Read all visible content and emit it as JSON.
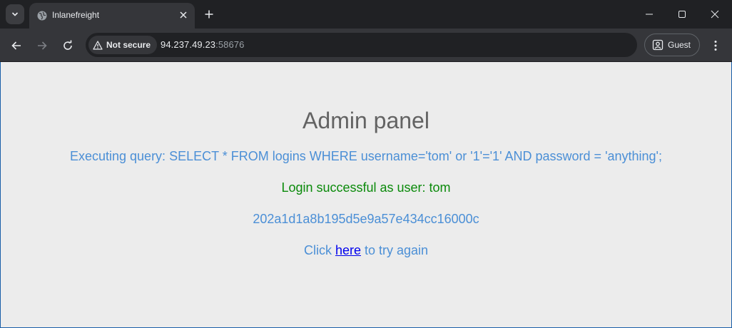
{
  "browser": {
    "tab": {
      "title": "Inlanefreight"
    },
    "security": {
      "label": "Not secure"
    },
    "address": {
      "host": "94.237.49.23",
      "port": ":58676"
    },
    "profile": {
      "label": "Guest"
    }
  },
  "page": {
    "title": "Admin panel",
    "query": "Executing query: SELECT * FROM logins WHERE username='tom' or '1'='1' AND password = 'anything';",
    "success": "Login successful as user: tom",
    "hash": "202a1d1a8b195d5e9a57e434cc16000c",
    "retry": {
      "prefix": "Click ",
      "link": "here",
      "suffix": " to try again"
    }
  },
  "colors": {
    "accent_text": "#4b8fd6",
    "success_text": "#0a8a0a",
    "title_text": "#636363",
    "page_background": "#ececec",
    "link": "#0000ee"
  },
  "icons": [
    "tab-search-icon",
    "globe-icon",
    "close-icon",
    "plus-icon",
    "minimize-icon",
    "maximize-icon",
    "back-arrow-icon",
    "forward-arrow-icon",
    "reload-icon",
    "warning-icon",
    "profile-icon",
    "kebab-menu-icon"
  ]
}
